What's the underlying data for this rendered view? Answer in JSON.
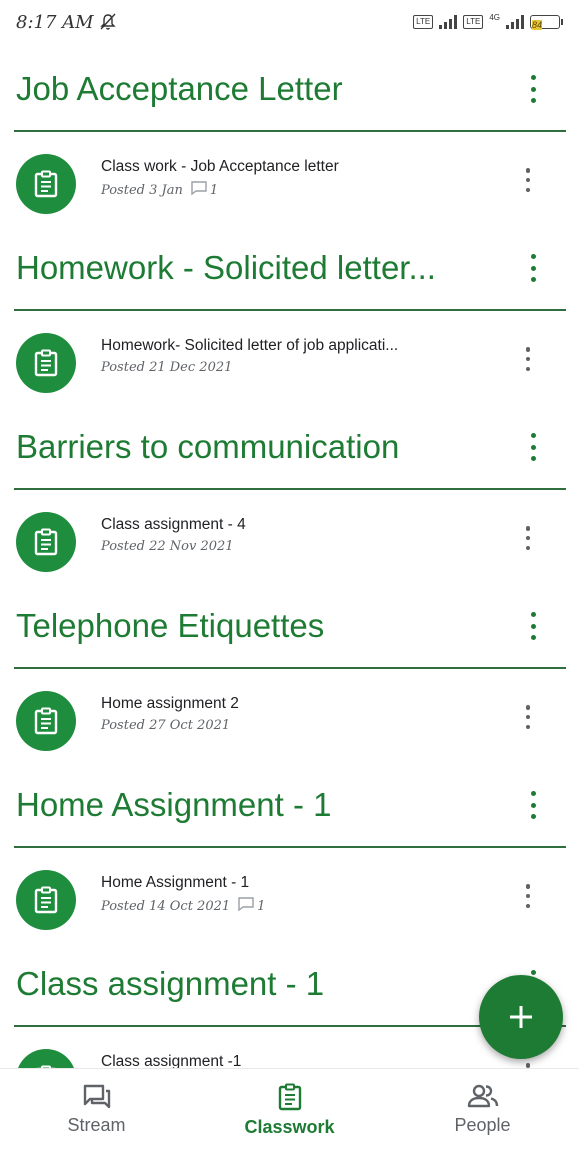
{
  "status_bar": {
    "time": "8:17 AM",
    "lte1": "LTE",
    "lte2": "LTE",
    "net": "4G",
    "battery": "84"
  },
  "colors": {
    "accent": "#1e7b34",
    "icon_bg": "#1e8e3e"
  },
  "topics": [
    {
      "title": "Job Acceptance Letter",
      "item": {
        "title": "Class work - Job Acceptance letter",
        "posted": "Posted 3 Jan",
        "comments": "1"
      }
    },
    {
      "title": "Homework - Solicited letter...",
      "item": {
        "title": "Homework- Solicited letter of job applicati...",
        "posted": "Posted 21 Dec 2021",
        "comments": null
      }
    },
    {
      "title": "Barriers to communication",
      "item": {
        "title": "Class assignment - 4",
        "posted": "Posted 22 Nov 2021",
        "comments": null
      }
    },
    {
      "title": "Telephone Etiquettes",
      "item": {
        "title": "Home assignment 2",
        "posted": "Posted 27 Oct 2021",
        "comments": null
      }
    },
    {
      "title": "Home Assignment - 1",
      "item": {
        "title": "Home Assignment - 1",
        "posted": "Posted 14 Oct 2021",
        "comments": "1"
      }
    },
    {
      "title": "Class assignment - 1",
      "item": {
        "title": "Class assignment -1",
        "posted": "",
        "comments": null
      }
    }
  ],
  "fab": {
    "icon": "plus-icon"
  },
  "bottom_nav": [
    {
      "label": "Stream",
      "icon": "stream-icon",
      "active": false
    },
    {
      "label": "Classwork",
      "icon": "classwork-icon",
      "active": true
    },
    {
      "label": "People",
      "icon": "people-icon",
      "active": false
    }
  ]
}
